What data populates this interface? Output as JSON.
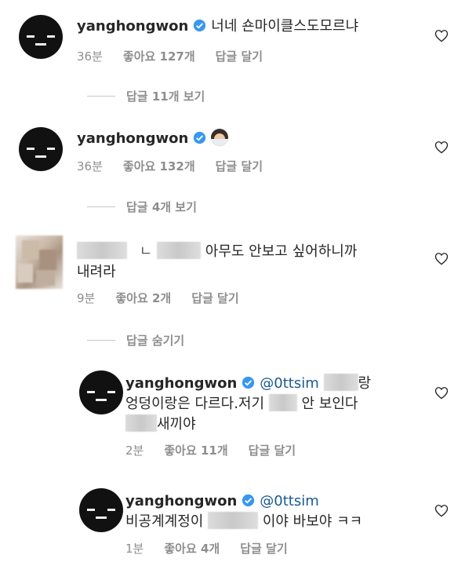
{
  "comments": [
    {
      "username": "yanghongwon",
      "text": "너네 숀마이클스도모르냐",
      "time": "36분",
      "likes": "좋아요 127개",
      "reply": "답글 달기",
      "view_replies": "답글 11개 보기"
    },
    {
      "username": "yanghongwon",
      "text": "",
      "emoji": "person-shrugging-emoji",
      "time": "36분",
      "likes": "좋아요 132개",
      "reply": "답글 달기",
      "view_replies": "답글 4개 보기"
    },
    {
      "username": "",
      "text_a": "ㄴ",
      "text_b": "아무도 안보고 싶어하니까",
      "text_line2": "내려라",
      "time": "9분",
      "likes": "좋아요 2개",
      "reply": "답글 달기",
      "hide_replies": "답글 숨기기"
    }
  ],
  "replies": [
    {
      "username": "yanghongwon",
      "mention": "@0ttsim",
      "text_after_mention": "랑",
      "line2_a": "엉덩이랑은 다르다.저기",
      "line2_b": "안 보인다",
      "line3_a": "새끼야",
      "time": "2분",
      "likes": "좋아요 11개",
      "reply": "답글 달기"
    },
    {
      "username": "yanghongwon",
      "mention": "@0ttsim",
      "line2_a": "비공계계정이",
      "line2_b": "이야 바보야 ㅋㅋ",
      "time": "1분",
      "likes": "좋아요 4개",
      "reply": "답글 달기"
    }
  ],
  "colors": {
    "text": "#262626",
    "meta": "#8e8e8e",
    "verified": "#3897f0",
    "mention": "#1a5a8f"
  },
  "icons": {
    "like": "heart-outline-icon",
    "verified": "verified-badge-icon",
    "avatar": "expressionless-face-avatar"
  }
}
